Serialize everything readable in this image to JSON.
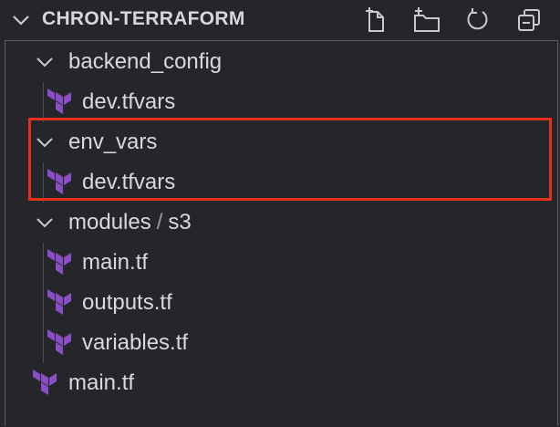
{
  "explorer": {
    "section_title": "CHRON-TERRAFORM",
    "actions": [
      {
        "name": "new-file-button",
        "icon": "new-file-icon"
      },
      {
        "name": "new-folder-button",
        "icon": "new-folder-icon"
      },
      {
        "name": "refresh-button",
        "icon": "refresh-icon"
      },
      {
        "name": "collapse-all-button",
        "icon": "collapse-all-icon"
      }
    ]
  },
  "tree": {
    "backend_config": {
      "label": "backend_config",
      "file": "dev.tfvars"
    },
    "env_vars": {
      "label": "env_vars",
      "file": "dev.tfvars"
    },
    "modules": {
      "label": "modules",
      "separator": "/",
      "sublabel": "s3",
      "files": [
        "main.tf",
        "outputs.tf",
        "variables.tf"
      ]
    },
    "root_file": "main.tf"
  },
  "colors": {
    "background": "#25262a",
    "text": "#d8d9dc",
    "terraform_icon": "#8a4fc6",
    "highlight": "#e5311b"
  }
}
